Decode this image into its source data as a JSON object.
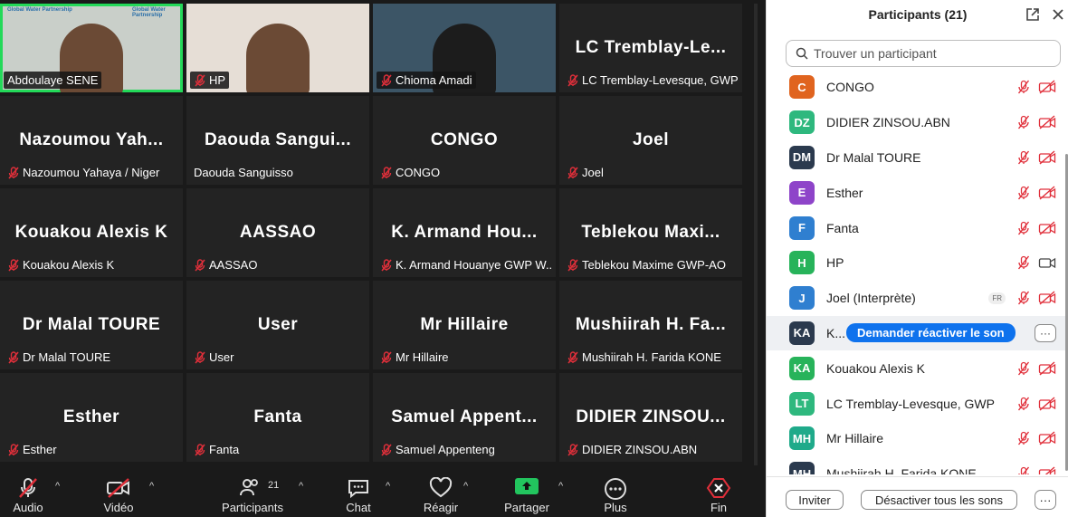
{
  "grid": [
    {
      "name": "Abdoulaye SENE",
      "big": "",
      "video": true,
      "active": true,
      "muted": false
    },
    {
      "name": "HP",
      "big": "",
      "video": true,
      "muted": true
    },
    {
      "name": "Chioma Amadi",
      "big": "",
      "video": true,
      "muted": true
    },
    {
      "name": "LC Tremblay-Levesque, GWP",
      "big": "LC Tremblay-Le...",
      "video": false,
      "muted": true
    },
    {
      "name": "Nazoumou Yahaya / Niger",
      "big": "Nazoumou Yah...",
      "video": false,
      "muted": true
    },
    {
      "name": "Daouda Sanguisso",
      "big": "Daouda Sangui...",
      "video": false,
      "muted": false
    },
    {
      "name": "CONGO",
      "big": "CONGO",
      "video": false,
      "muted": true
    },
    {
      "name": "Joel",
      "big": "Joel",
      "video": false,
      "muted": true
    },
    {
      "name": "Kouakou Alexis K",
      "big": "Kouakou Alexis K",
      "video": false,
      "muted": true
    },
    {
      "name": "AASSAO",
      "big": "AASSAO",
      "video": false,
      "muted": true
    },
    {
      "name": "K. Armand Houanye GWP W...",
      "big": "K. Armand Hou...",
      "video": false,
      "muted": true
    },
    {
      "name": "Teblekou Maxime GWP-AO",
      "big": "Teblekou Maxi...",
      "video": false,
      "muted": true
    },
    {
      "name": "Dr Malal TOURE",
      "big": "Dr Malal TOURE",
      "video": false,
      "muted": true
    },
    {
      "name": "User",
      "big": "User",
      "video": false,
      "muted": true
    },
    {
      "name": "Mr Hillaire",
      "big": "Mr Hillaire",
      "video": false,
      "muted": true
    },
    {
      "name": "Mushiirah H. Farida KONE",
      "big": "Mushiirah H. Fa...",
      "video": false,
      "muted": true
    },
    {
      "name": "Esther",
      "big": "Esther",
      "video": false,
      "muted": true
    },
    {
      "name": "Fanta",
      "big": "Fanta",
      "video": false,
      "muted": true
    },
    {
      "name": "Samuel Appenteng",
      "big": "Samuel Appent...",
      "video": false,
      "muted": true
    },
    {
      "name": "DIDIER ZINSOU.ABN",
      "big": "DIDIER ZINSOU...",
      "video": false,
      "muted": true
    }
  ],
  "tile_logo_text": "Global Water Partnership",
  "toolbar": {
    "audio": "Audio",
    "video": "Vidéo",
    "participants": "Participants",
    "participants_count": "21",
    "chat": "Chat",
    "react": "Réagir",
    "share": "Partager",
    "apps": "Plus",
    "end": "Fin"
  },
  "panel": {
    "title": "Participants (21)",
    "search_placeholder": "Trouver un participant",
    "participants": [
      {
        "initials": "C",
        "name": "CONGO",
        "color": "#e0641f",
        "video": "off"
      },
      {
        "initials": "DZ",
        "name": "DIDIER ZINSOU.ABN",
        "color": "#2eb87e",
        "video": "off"
      },
      {
        "initials": "DM",
        "name": "Dr Malal TOURE",
        "color": "#2b3a4e",
        "video": "off"
      },
      {
        "initials": "E",
        "name": "Esther",
        "color": "#8e44c9",
        "video": "off"
      },
      {
        "initials": "F",
        "name": "Fanta",
        "color": "#2f7fd0",
        "video": "off"
      },
      {
        "initials": "H",
        "name": "HP",
        "color": "#27b35a",
        "video": "on"
      },
      {
        "initials": "J",
        "name": "Joel (Interprète)",
        "color": "#2f7fd0",
        "video": "off",
        "badge": "FR"
      },
      {
        "initials": "KA",
        "name": "K...",
        "color": "#2b3a4e",
        "video": "off",
        "selected": true
      },
      {
        "initials": "KA",
        "name": "Kouakou Alexis K",
        "color": "#27b35a",
        "video": "off"
      },
      {
        "initials": "LT",
        "name": "LC Tremblay-Levesque, GWP",
        "color": "#2eb87e",
        "video": "off"
      },
      {
        "initials": "MH",
        "name": "Mr Hillaire",
        "color": "#1faa8a",
        "video": "off"
      },
      {
        "initials": "MH",
        "name": "Mushiirah H. Farida KONE",
        "color": "#2b3a4e",
        "video": "off"
      }
    ],
    "request_unmute": "Demander réactiver le son",
    "more": "···",
    "invite": "Inviter",
    "mute_all": "Désactiver tous les sons",
    "footer_more": "···"
  }
}
